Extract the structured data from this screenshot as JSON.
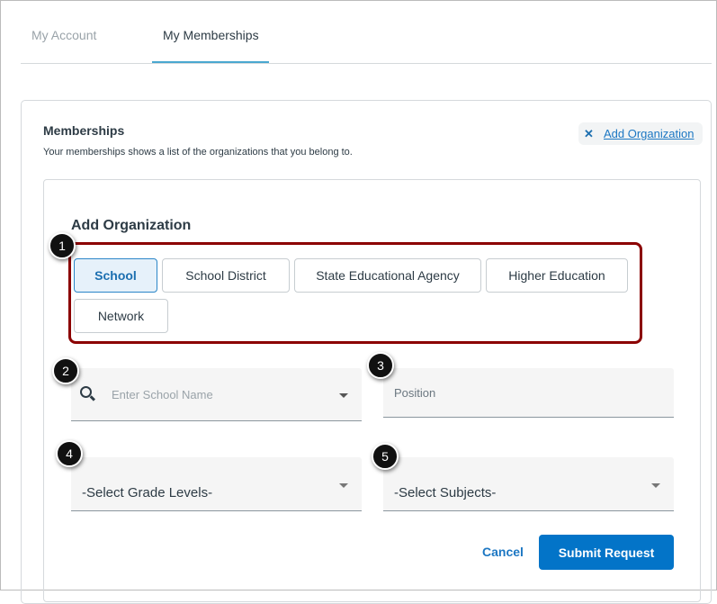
{
  "tabs": [
    {
      "label": "My Account",
      "active": false
    },
    {
      "label": "My Memberships",
      "active": true
    }
  ],
  "memberships": {
    "title": "Memberships",
    "description": "Your memberships shows a list of the organizations that you belong to.",
    "add_org_link": "Add Organization"
  },
  "form": {
    "title": "Add Organization",
    "org_types": [
      "School",
      "School District",
      "State Educational Agency",
      "Higher Education",
      "Network"
    ],
    "selected_type": "School",
    "school_placeholder": "Enter School Name",
    "position_placeholder": "Position",
    "grade_select": "-Select Grade Levels-",
    "subject_select": "-Select Subjects-",
    "cancel": "Cancel",
    "submit": "Submit Request"
  },
  "callouts": [
    "1",
    "2",
    "3",
    "4",
    "5"
  ],
  "colors": {
    "accent": "#0374c8",
    "highlight": "#8b0000",
    "tab_underline": "#4aa8d0"
  }
}
